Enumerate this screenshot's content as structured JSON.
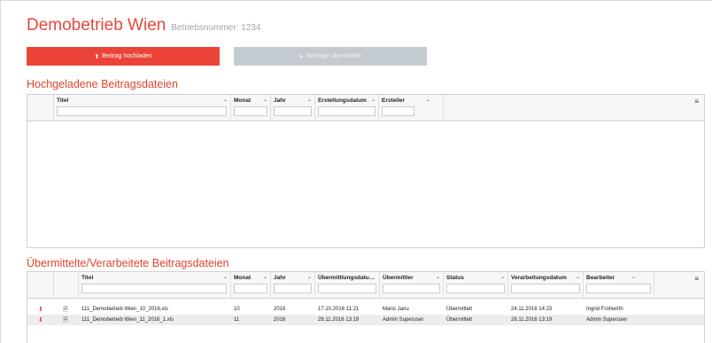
{
  "header": {
    "company": "Demobetrieb Wien",
    "betriebsnummer": "Betriebsnummer: 1234"
  },
  "actions": {
    "upload_label": "Beitrag hochladen",
    "submit_label": "Beiträge übermitteln",
    "upload_icon": "upload-icon",
    "submit_icon": "send-icon"
  },
  "uploaded": {
    "title": "Hochgeladene Beitragsdateien",
    "columns": [
      "Titel",
      "Monat",
      "Jahr",
      "Erstellungsdatum",
      "Ersteller"
    ],
    "rows": []
  },
  "processed": {
    "title": "Übermittelte/Verarbeitete Beitragsdateien",
    "columns": [
      "Titel",
      "Monat",
      "Jahr",
      "Übermittlungsdatu…",
      "Übermittler",
      "Status",
      "Verarbeitungsdatum",
      "Bearbeiter"
    ],
    "rows": [
      {
        "titel": "111_Demobetrieb Wien_10_2016.xls",
        "monat": "10",
        "jahr": "2016",
        "uebermittlungsdatum": "17.10.2016 11:21",
        "uebermittler": "Mario Janu",
        "status": "Übermittelt",
        "verarbeitungsdatum": "24.11.2016 14:23",
        "bearbeiter": "Ingrid Frühwirth"
      },
      {
        "titel": "111_Demobetrieb Wien_11_2016_1.xls",
        "monat": "11",
        "jahr": "2016",
        "uebermittlungsdatum": "28.11.2016 13:19",
        "uebermittler": "Admin Superuser",
        "status": "Übermittelt",
        "verarbeitungsdatum": "28.11.2016 13:19",
        "bearbeiter": "Admin Superuser"
      }
    ]
  },
  "colors": {
    "accent": "#ec4338",
    "disabled": "#c4cbd0",
    "title": "#e0432d"
  }
}
